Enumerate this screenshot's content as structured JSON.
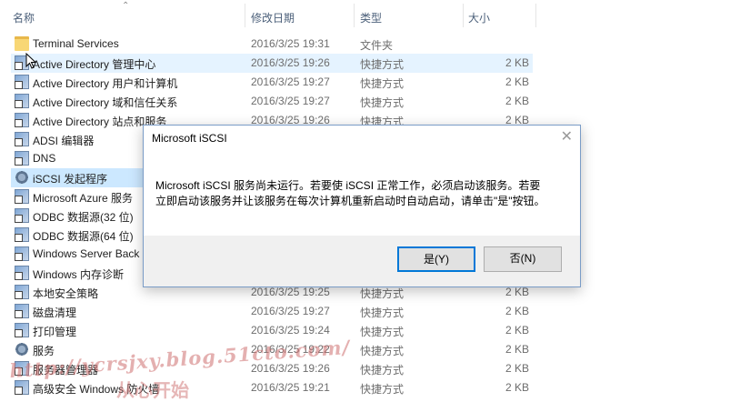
{
  "columns": {
    "name": "名称",
    "date": "修改日期",
    "type": "类型",
    "size": "大小"
  },
  "files": [
    {
      "name": "Terminal Services",
      "date": "2016/3/25 19:31",
      "type": "文件夹",
      "size": "",
      "icon": "folder-icon"
    },
    {
      "name": "Active Directory 管理中心",
      "date": "2016/3/25 19:26",
      "type": "快捷方式",
      "size": "2 KB",
      "icon": "shortcut-icon"
    },
    {
      "name": "Active Directory 用户和计算机",
      "date": "2016/3/25 19:27",
      "type": "快捷方式",
      "size": "2 KB",
      "icon": "shortcut-icon"
    },
    {
      "name": "Active Directory 域和信任关系",
      "date": "2016/3/25 19:27",
      "type": "快捷方式",
      "size": "2 KB",
      "icon": "shortcut-icon"
    },
    {
      "name": "Active Directory 站点和服务",
      "date": "2016/3/25 19:26",
      "type": "快捷方式",
      "size": "2 KB",
      "icon": "shortcut-icon"
    },
    {
      "name": "ADSI 编辑器",
      "date": "",
      "type": "",
      "size": "",
      "icon": "shortcut-icon"
    },
    {
      "name": "DNS",
      "date": "",
      "type": "",
      "size": "",
      "icon": "shortcut-icon"
    },
    {
      "name": "iSCSI 发起程序",
      "date": "",
      "type": "",
      "size": "",
      "icon": "gear-icon"
    },
    {
      "name": "Microsoft Azure 服务",
      "date": "",
      "type": "",
      "size": "",
      "icon": "shortcut-icon"
    },
    {
      "name": "ODBC 数据源(32 位)",
      "date": "",
      "type": "",
      "size": "",
      "icon": "shortcut-icon"
    },
    {
      "name": "ODBC 数据源(64 位)",
      "date": "",
      "type": "",
      "size": "",
      "icon": "shortcut-icon"
    },
    {
      "name": "Windows Server Back",
      "date": "",
      "type": "",
      "size": "",
      "icon": "shortcut-icon"
    },
    {
      "name": "Windows 内存诊断",
      "date": "",
      "type": "",
      "size": "",
      "icon": "shortcut-icon"
    },
    {
      "name": "本地安全策略",
      "date": "2016/3/25 19:25",
      "type": "快捷方式",
      "size": "2 KB",
      "icon": "shortcut-icon"
    },
    {
      "name": "磁盘清理",
      "date": "2016/3/25 19:27",
      "type": "快捷方式",
      "size": "2 KB",
      "icon": "shortcut-icon"
    },
    {
      "name": "打印管理",
      "date": "2016/3/25 19:24",
      "type": "快捷方式",
      "size": "2 KB",
      "icon": "shortcut-icon"
    },
    {
      "name": "服务",
      "date": "2016/3/25 19:22",
      "type": "快捷方式",
      "size": "2 KB",
      "icon": "gear-icon"
    },
    {
      "name": "服务器管理器",
      "date": "2016/3/25 19:26",
      "type": "快捷方式",
      "size": "2 KB",
      "icon": "shortcut-icon"
    },
    {
      "name": "高级安全 Windows 防火墙",
      "date": "2016/3/25 19:21",
      "type": "快捷方式",
      "size": "2 KB",
      "icon": "shortcut-icon"
    }
  ],
  "dialog": {
    "title": "Microsoft iSCSI",
    "close_glyph": "✕",
    "message_line1": "Microsoft iSCSI 服务尚未运行。若要使 iSCSI 正常工作，必须启动该服务。若要",
    "message_line2": "立即启动该服务并让该服务在每次计算机重新启动时自动启动，请单击\"是\"按钮。",
    "yes_label": "是(Y)",
    "no_label": "否(N)"
  },
  "watermark": {
    "url": "http://ycrsjxy.blog.51cto.com/",
    "tagline": "从心开始"
  },
  "colors": {
    "hover_row": "#e5f3ff",
    "selected_row": "#cce8ff",
    "default_button_border": "#0078d7",
    "watermark": "#ce6f6f"
  }
}
